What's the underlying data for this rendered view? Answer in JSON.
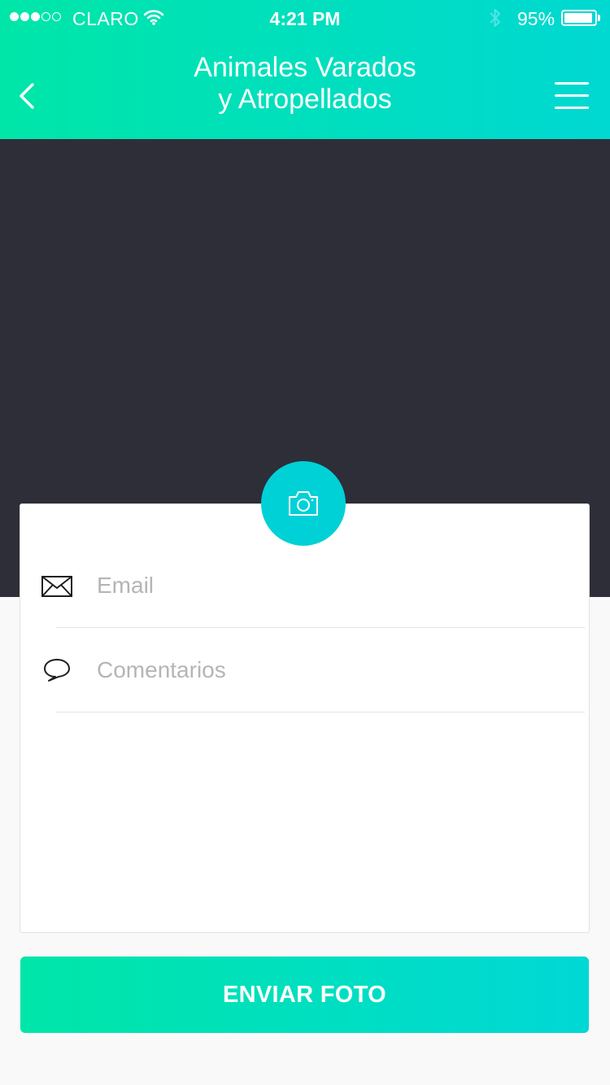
{
  "status_bar": {
    "carrier": "CLARO",
    "time": "4:21 PM",
    "battery": "95%",
    "signal_bars_filled": 3,
    "signal_bars_total": 5,
    "battery_level": 0.95
  },
  "header": {
    "title_line1": "Animales Varados",
    "title_line2": "y Atropellados",
    "back_icon": "chevron-left-icon",
    "menu_icon": "hamburger-menu-icon"
  },
  "photo": {
    "camera_icon": "camera-icon"
  },
  "form": {
    "email_placeholder": "Email",
    "email_value": "",
    "email_icon": "envelope-icon",
    "comments_placeholder": "Comentarios",
    "comments_value": "",
    "comments_icon": "speech-bubble-icon"
  },
  "submit": {
    "label": "ENVIAR FOTO"
  },
  "colors": {
    "accent_start": "#00e6a8",
    "accent_end": "#00d8d2",
    "camera_button": "#00d1d6",
    "photo_background": "#2e2e39",
    "page_background": "#f9f9f9"
  }
}
